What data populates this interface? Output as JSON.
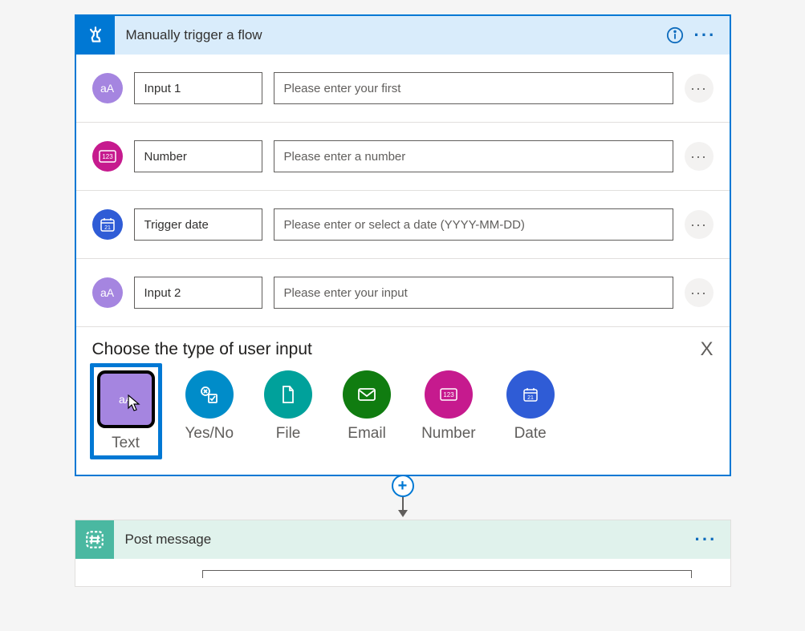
{
  "trigger": {
    "title": "Manually trigger a flow",
    "inputs": [
      {
        "icon": "text",
        "name": "Input 1",
        "placeholder": "Please enter your first"
      },
      {
        "icon": "number",
        "name": "Number",
        "placeholder": "Please enter a number"
      },
      {
        "icon": "date",
        "name": "Trigger date",
        "placeholder": "Please enter or select a date (YYYY-MM-DD)"
      },
      {
        "icon": "text",
        "name": "Input 2",
        "placeholder": "Please enter your input"
      }
    ]
  },
  "chooser": {
    "title": "Choose the type of user input",
    "close": "X",
    "types": [
      {
        "key": "text",
        "label": "Text",
        "selected": true
      },
      {
        "key": "yesno",
        "label": "Yes/No",
        "selected": false
      },
      {
        "key": "file",
        "label": "File",
        "selected": false
      },
      {
        "key": "email",
        "label": "Email",
        "selected": false
      },
      {
        "key": "number",
        "label": "Number",
        "selected": false
      },
      {
        "key": "date",
        "label": "Date",
        "selected": false
      }
    ]
  },
  "action": {
    "title": "Post message"
  },
  "colors": {
    "accent": "#0078d4",
    "text_badge": "#a585e0",
    "number_badge": "#c61a8e",
    "date_badge": "#2f5cd6",
    "file_badge": "#00a19b",
    "yesno_badge": "#008cc9",
    "email_badge": "#107c10",
    "post_badge": "#4ab8a1"
  }
}
